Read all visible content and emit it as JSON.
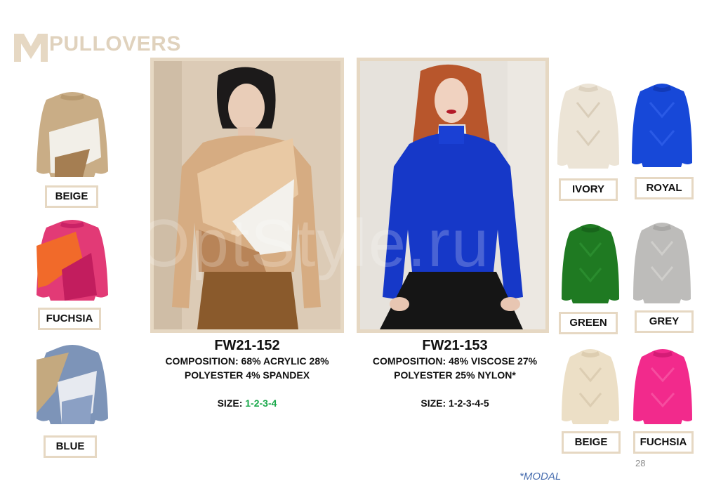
{
  "header": {
    "title": "PULLOVERS"
  },
  "watermark": "OptStyle.ru",
  "colors": {
    "accent": "#e6d8c3",
    "size_green": "#19a84a",
    "modal_blue": "#4a6fb0"
  },
  "left_swatches": [
    {
      "label": "BEIGE"
    },
    {
      "label": "FUCHSIA"
    },
    {
      "label": "BLUE"
    }
  ],
  "right_swatches": [
    {
      "label": "IVORY"
    },
    {
      "label": "ROYAL"
    },
    {
      "label": "GREEN"
    },
    {
      "label": "GREY"
    },
    {
      "label": "BEIGE"
    },
    {
      "label": "FUCHSIA"
    }
  ],
  "products": [
    {
      "code": "FW21-152",
      "composition_line1": "COMPOSITION: 68% ACRYLIC 28%",
      "composition_line2": "POLYESTER 4% SPANDEX",
      "size_label": "SIZE:",
      "size_value": "1-2-3-4"
    },
    {
      "code": "FW21-153",
      "composition_line1": "COMPOSITION: 48% VISCOSE 27%",
      "composition_line2": "POLYESTER 25% NYLON*",
      "size_label": "SIZE:",
      "size_value": "1-2-3-4-5"
    }
  ],
  "footer": {
    "page_number": "28",
    "note": "*MODAL"
  }
}
